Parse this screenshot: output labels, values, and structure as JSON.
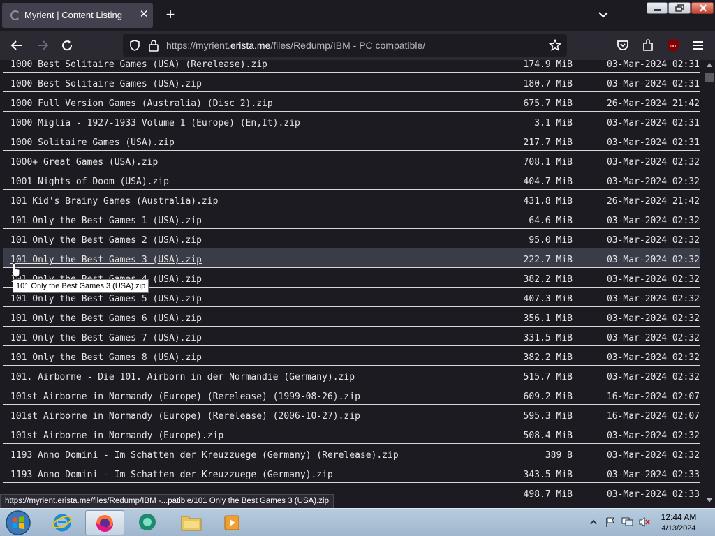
{
  "browser": {
    "tab_title": "Myrient | Content Listing",
    "url_prefix": "https://myrient.",
    "url_host": "erista.me",
    "url_path": "/files/Redump/IBM - PC compatible/",
    "status_url": "https://myrient.erista.me/files/Redump/IBM -...patible/101 Only the Best Games 3 (USA).zip",
    "tooltip": "101 Only the Best Games 3 (USA).zip",
    "accent_color": "#1c1b22"
  },
  "listing": {
    "highlighted_index": 10,
    "rows": [
      {
        "name": "1000 Best Solitaire Games (USA) (Rerelease).zip",
        "size": "174.9 MiB",
        "date": "03-Mar-2024 02:31"
      },
      {
        "name": "1000 Best Solitaire Games (USA).zip",
        "size": "180.7 MiB",
        "date": "03-Mar-2024 02:31"
      },
      {
        "name": "1000 Full Version Games (Australia) (Disc 2).zip",
        "size": "675.7 MiB",
        "date": "26-Mar-2024 21:42"
      },
      {
        "name": "1000 Miglia - 1927-1933 Volume 1 (Europe) (En,It).zip",
        "size": "3.1 MiB",
        "date": "03-Mar-2024 02:31"
      },
      {
        "name": "1000 Solitaire Games (USA).zip",
        "size": "217.7 MiB",
        "date": "03-Mar-2024 02:31"
      },
      {
        "name": "1000+ Great Games (USA).zip",
        "size": "708.1 MiB",
        "date": "03-Mar-2024 02:32"
      },
      {
        "name": "1001 Nights of Doom (USA).zip",
        "size": "404.7 MiB",
        "date": "03-Mar-2024 02:32"
      },
      {
        "name": "101 Kid's Brainy Games (Australia).zip",
        "size": "431.8 MiB",
        "date": "26-Mar-2024 21:42"
      },
      {
        "name": "101 Only the Best Games 1 (USA).zip",
        "size": "64.6 MiB",
        "date": "03-Mar-2024 02:32"
      },
      {
        "name": "101 Only the Best Games 2 (USA).zip",
        "size": "95.0 MiB",
        "date": "03-Mar-2024 02:32"
      },
      {
        "name": "101 Only the Best Games 3 (USA).zip",
        "size": "222.7 MiB",
        "date": "03-Mar-2024 02:32"
      },
      {
        "name": "101 Only the Best Games 4 (USA).zip",
        "size": "382.2 MiB",
        "date": "03-Mar-2024 02:32"
      },
      {
        "name": "101 Only the Best Games 5 (USA).zip",
        "size": "407.3 MiB",
        "date": "03-Mar-2024 02:32"
      },
      {
        "name": "101 Only the Best Games 6 (USA).zip",
        "size": "356.1 MiB",
        "date": "03-Mar-2024 02:32"
      },
      {
        "name": "101 Only the Best Games 7 (USA).zip",
        "size": "331.5 MiB",
        "date": "03-Mar-2024 02:32"
      },
      {
        "name": "101 Only the Best Games 8 (USA).zip",
        "size": "382.2 MiB",
        "date": "03-Mar-2024 02:32"
      },
      {
        "name": "101. Airborne - Die 101. Airborn in der Normandie (Germany).zip",
        "size": "515.7 MiB",
        "date": "03-Mar-2024 02:32"
      },
      {
        "name": "101st Airborne in Normandy (Europe) (Rerelease) (1999-08-26).zip",
        "size": "609.2 MiB",
        "date": "16-Mar-2024 02:07"
      },
      {
        "name": "101st Airborne in Normandy (Europe) (Rerelease) (2006-10-27).zip",
        "size": "595.3 MiB",
        "date": "16-Mar-2024 02:07"
      },
      {
        "name": "101st Airborne in Normandy (Europe).zip",
        "size": "508.4 MiB",
        "date": "03-Mar-2024 02:32"
      },
      {
        "name": "1193 Anno Domini - Im Schatten der Kreuzzuege (Germany) (Rerelease).zip",
        "size": "389 B",
        "date": "03-Mar-2024 02:32"
      },
      {
        "name": "1193 Anno Domini - Im Schatten der Kreuzzuege (Germany).zip",
        "size": "343.5 MiB",
        "date": "03-Mar-2024 02:33"
      },
      {
        "name": "",
        "size": "498.7 MiB",
        "date": "03-Mar-2024 02:33"
      }
    ]
  },
  "taskbar": {
    "apps": [
      "internet-explorer-icon",
      "firefox-icon",
      "chat-icon",
      "file-explorer-icon",
      "media-player-icon"
    ],
    "time": "12:44 AM",
    "date": "4/13/2024"
  }
}
